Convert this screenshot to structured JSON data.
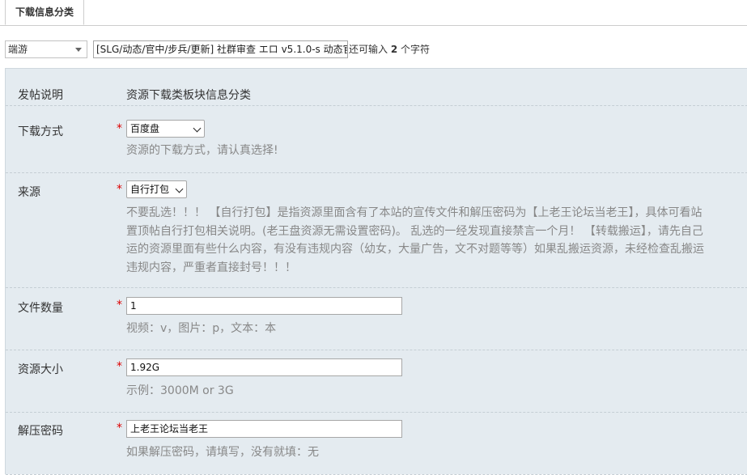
{
  "tabs": [
    {
      "label": "下载信息分类"
    }
  ],
  "toolbar": {
    "type_select": "端游",
    "title_value": "[SLG/动态/官中/步兵/更新] 社群审查 エロ v5.1.0-s 动态官",
    "count_prefix": "还可输入",
    "count_value": "2",
    "count_suffix": "个字符"
  },
  "form": {
    "post_note": {
      "label": "发帖说明",
      "value": "资源下载类板块信息分类"
    },
    "download_method": {
      "label": "下载方式",
      "required": "*",
      "selected": "百度盘",
      "hint": "资源的下载方式，请认真选择!"
    },
    "source": {
      "label": "来源",
      "required": "*",
      "selected": "自行打包",
      "desc_lines": [
        "不要乱选！！！ 【自行打包】是指资源里面含有了本站的宣传文件和解压密码为【上老王论坛当老王】，具体可看站",
        "置顶帖自行打包相关说明。(老王盘资源无需设置密码)。 乱选的一经发现直接禁言一个月！ 【转载搬运】，请先自己",
        "运的资源里面有些什么内容，有没有违规内容（幼女，大量广告，文不对题等等）如果乱搬运资源，未经检查乱搬运",
        "违规内容，严重者直接封号！！！"
      ]
    },
    "file_count": {
      "label": "文件数量",
      "required": "*",
      "value": "1",
      "hint": "视频：v，图片：p，文本：本"
    },
    "resource_size": {
      "label": "资源大小",
      "required": "*",
      "value": "1.92G",
      "hint": "示例：3000M or 3G"
    },
    "password": {
      "label": "解压密码",
      "required": "*",
      "value": "上老王论坛当老王",
      "hint": "如果解压密码，请填写，没有就填：无"
    }
  },
  "colors": {
    "panel_bg": "#e4ebf0",
    "required": "#dd0000",
    "hint": "#888888"
  }
}
